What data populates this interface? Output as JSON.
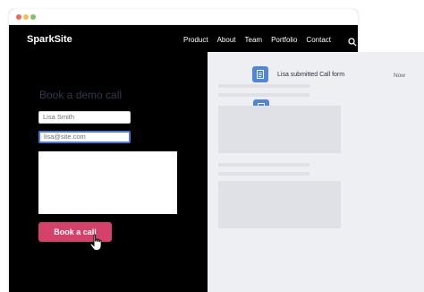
{
  "site": {
    "brand": "SparkSite",
    "nav": [
      "Product",
      "About",
      "Team",
      "Portfolio",
      "Contact"
    ]
  },
  "form": {
    "title": "Book a demo call",
    "name_value": "Lisa Smith",
    "email_value": "lisa@site.com",
    "submit_label": "Book a call"
  },
  "activity": {
    "notification_text": "Lisa submitted Call form",
    "notification_time": "Now"
  },
  "colors": {
    "accent_button": "#d4416a",
    "focus_outline": "#4a7ce0",
    "feed_icon": "#4f86dc",
    "panel_bg": "#edeff3"
  },
  "icons": [
    "search-icon",
    "document-icon",
    "hand-cursor-icon"
  ]
}
